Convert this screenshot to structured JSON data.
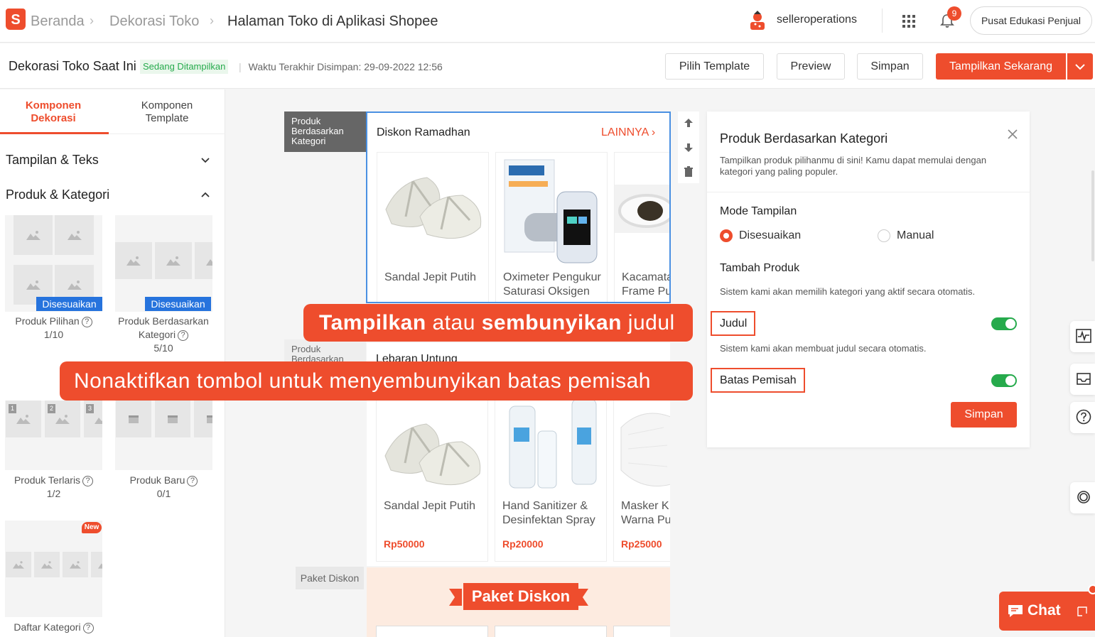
{
  "topnav": {
    "breadcrumbs": [
      "Beranda",
      "Dekorasi Toko",
      "Halaman Toko di Aplikasi Shopee"
    ],
    "logo_letter": "S",
    "username": "selleroperations",
    "notification_count": "9",
    "edu_button": "Pusat Edukasi Penjual"
  },
  "subbar": {
    "title": "Dekorasi Toko Saat Ini",
    "status_badge": "Sedang Ditampilkan",
    "divider": "|",
    "saved_time": "Waktu Terakhir Disimpan: 29-09-2022 12:56",
    "buttons": {
      "template": "Pilih Template",
      "preview": "Preview",
      "save": "Simpan",
      "publish": "Tampilkan Sekarang"
    }
  },
  "left_panel": {
    "tabs": [
      {
        "label_1": "Komponen",
        "label_2": "Dekorasi"
      },
      {
        "label_1": "Komponen",
        "label_2": "Template"
      }
    ],
    "sections": [
      "Tampilan & Teks",
      "Produk & Kategori"
    ],
    "components": [
      {
        "name": "Produk Pilihan",
        "count": "1/10",
        "tag": "Disesuaikan"
      },
      {
        "name_1": "Produk Berdasarkan",
        "name_2": "Kategori",
        "count": "5/10",
        "tag": "Disesuaikan"
      },
      {
        "name": "Produk Terlaris",
        "count": "1/2",
        "ranks": [
          "1",
          "2",
          "3"
        ]
      },
      {
        "name": "Produk Baru",
        "count": "0/1"
      },
      {
        "name": "Daftar Kategori",
        "new_tag": "New"
      }
    ],
    "help_glyph": "?"
  },
  "canvas": {
    "side_labels": {
      "current": [
        "Produk",
        "Berdasarkan",
        "Kategori"
      ],
      "next": [
        "Produk",
        "Berdasarkan"
      ],
      "paket": "Paket Diskon"
    },
    "section1": {
      "title": "Diskon Ramadhan",
      "more": "LAINNYA",
      "products": [
        {
          "name_1": "Sandal Jepit Putih",
          "name_2": ""
        },
        {
          "name_1": "Oximeter Pengukur",
          "name_2": "Saturasi Oksigen"
        },
        {
          "name_1": "Kacamata",
          "name_2": "Frame Pu"
        }
      ]
    },
    "section2": {
      "title": "Lebaran Untung",
      "products": [
        {
          "name_1": "Sandal Jepit Putih",
          "name_2": "",
          "price": "Rp50000"
        },
        {
          "name_1": "Hand Sanitizer &",
          "name_2": "Desinfektan Spray",
          "price": "Rp20000"
        },
        {
          "name_1": "Masker KI",
          "name_2": "Warna Pu",
          "price": "Rp25000"
        }
      ]
    },
    "paket_title": "Paket Diskon"
  },
  "settings": {
    "title": "Produk Berdasarkan Kategori",
    "description": "Tampilkan produk pilihanmu di sini! Kamu dapat memulai dengan kategori yang paling populer.",
    "mode_label": "Mode Tampilan",
    "mode_options": [
      "Disesuaikan",
      "Manual"
    ],
    "mode_selected": "Disesuaikan",
    "add_label": "Tambah Produk",
    "add_hint": "Sistem kami akan memilih kategori yang aktif secara otomatis.",
    "title_toggle_label": "Judul",
    "title_toggle_on": true,
    "title_hint": "Sistem kami akan membuat judul secara otomatis.",
    "divider_toggle_label": "Batas Pemisah",
    "divider_toggle_on": true,
    "save": "Simpan"
  },
  "callouts": {
    "c1_part1": "Tampilkan",
    "c1_part2": " atau ",
    "c1_part3": "sembunyikan",
    "c1_part4": " judul",
    "c2": "Nonaktifkan tombol untuk menyembunyikan batas pemisah"
  },
  "chat": {
    "label": "Chat"
  },
  "colors": {
    "accent": "#ee4d2d",
    "blue_tag": "#2673dd",
    "toggle_on": "#26aa4c",
    "selected_border": "#4a90e2"
  }
}
